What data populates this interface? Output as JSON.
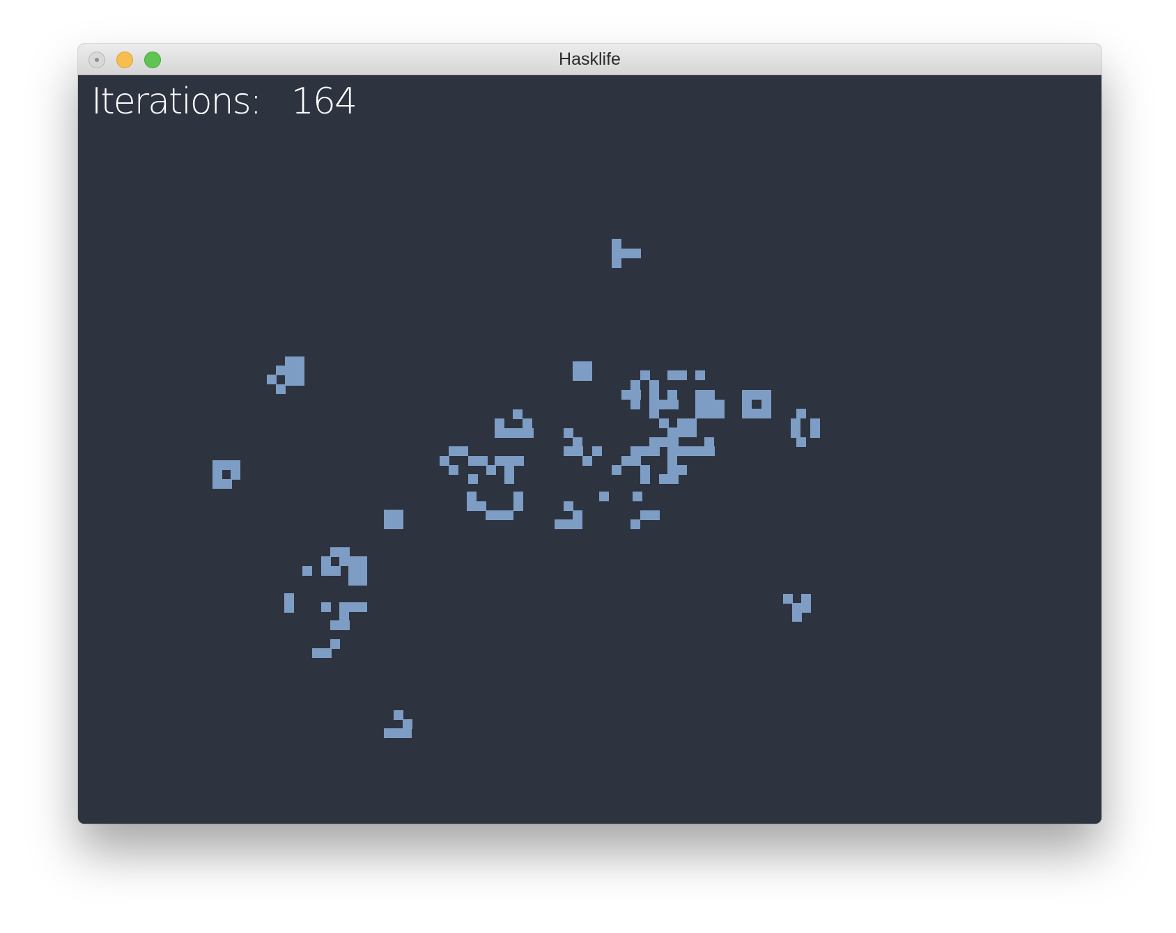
{
  "window": {
    "title": "Hasklife"
  },
  "hud": {
    "iterations_label": "Iterations:",
    "iterations_value": "164"
  },
  "colors": {
    "background": "#2e3340",
    "cell": "#7d9dc4",
    "text": "#ffffff"
  },
  "icons": {
    "close": "close-icon",
    "minimize": "minimize-icon",
    "zoom": "zoom-icon"
  }
}
